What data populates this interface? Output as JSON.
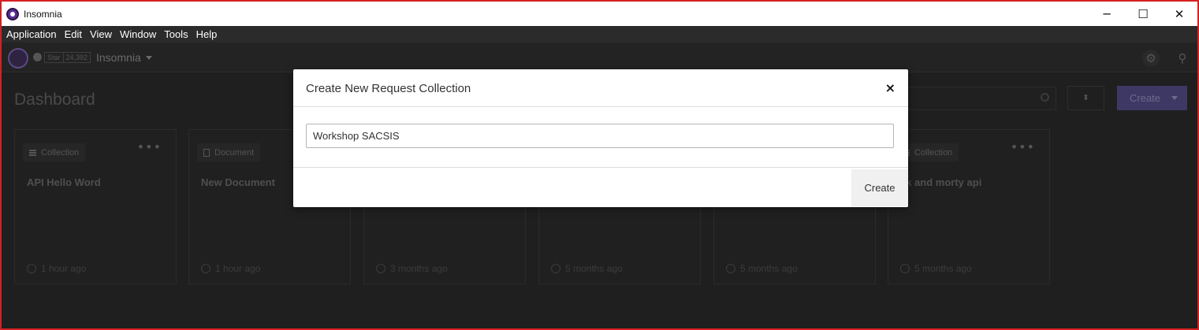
{
  "window": {
    "title": "Insomnia",
    "controls": {
      "minimize": "─",
      "maximize": "☐",
      "close": "✕"
    }
  },
  "menubar": {
    "items": [
      "Application",
      "Edit",
      "View",
      "Window",
      "Tools",
      "Help"
    ]
  },
  "header": {
    "star_label": "Star",
    "star_count": "24,392",
    "project_name": "Insomnia",
    "settings_icon": "gear-icon",
    "account_icon": "person-icon"
  },
  "dashboard": {
    "title": "Dashboard",
    "search_placeholder": "",
    "create_label": "Create",
    "cards": [
      {
        "type": "Collection",
        "name": "API Hello Word",
        "time": "1 hour ago"
      },
      {
        "type": "Document",
        "name": "New Document",
        "time": "1 hour ago"
      },
      {
        "type": "",
        "name": "",
        "time": "3 months ago"
      },
      {
        "type": "",
        "name": "",
        "time": "5 months ago"
      },
      {
        "type": "",
        "name": "",
        "time": "5 months ago"
      },
      {
        "type": "Collection",
        "name": "ck and morty api",
        "time": "5 months ago"
      }
    ]
  },
  "modal": {
    "title": "Create New Request Collection",
    "close_symbol": "×",
    "input_value": "Workshop SACSIS",
    "create_label": "Create"
  },
  "colors": {
    "background": "#1f1f1f",
    "accent": "#3e3865",
    "border_highlight": "#d62020"
  }
}
